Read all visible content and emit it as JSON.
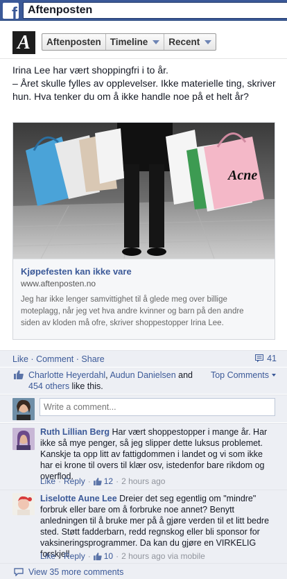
{
  "topbar": {
    "title": "Aftenposten"
  },
  "page_nav": {
    "logo_letter": "A",
    "page_button": "Aftenposten",
    "timeline_button": "Timeline",
    "recent_button": "Recent"
  },
  "post": {
    "text": "Irina Lee har vært shoppingfri i to år.\n– Året skulle fylles av opplevelser. Ikke materielle ting, skriver hun. Hva tenker du om å ikke handle noe på et helt år?",
    "image_bag_label": "Acne",
    "share_title": "Kjøpefesten kan ikke vare",
    "share_domain": "www.aftenposten.no",
    "share_description": "Jeg har ikke lenger samvittighet til å glede meg over billige moteplagg, når jeg vet hva andre kvinner og barn på den andre siden av kloden må ofre, skriver shoppestopper Irina Lee."
  },
  "actions": {
    "like": "Like",
    "comment": "Comment",
    "share": "Share",
    "separator": "·",
    "comment_count": "41"
  },
  "likes": {
    "name1": "Charlotte Heyerdahl",
    "name2": "Audun Danielsen",
    "and": " and",
    "others": "454 others",
    "suffix": " like this.",
    "sort_label": "Top Comments"
  },
  "composer": {
    "placeholder": "Write a comment..."
  },
  "comments": [
    {
      "author": "Ruth Lillian Berg",
      "text": "Har vært shoppestopper i mange år. Har ikke så mye penger, så jeg slipper dette luksus problemet. Kanskje ta opp litt av fattigdommen i landet og vi som ikke har ei krone til overs til klær osv, istedenfor bare rikdom og overflod.",
      "like": "Like",
      "reply": "Reply",
      "likes": "12",
      "time": "2 hours ago"
    },
    {
      "author": "Liselotte Aune Lee",
      "text": "Dreier det seg egentlig om \"mindre\" forbruk eller bare om å forbruke noe annet? Benytt anledningen til å bruke mer på å gjøre verden til et litt bedre sted. Støtt fadderbarn, redd regnskog eller bli sponsor for vaksineringsprogrammer. Da kan du gjøre en VIRKELIG forskjell.",
      "like": "Like",
      "reply": "Reply",
      "likes": "10",
      "time": "2 hours ago via mobile"
    }
  ],
  "more_comments": "View 35 more comments"
}
